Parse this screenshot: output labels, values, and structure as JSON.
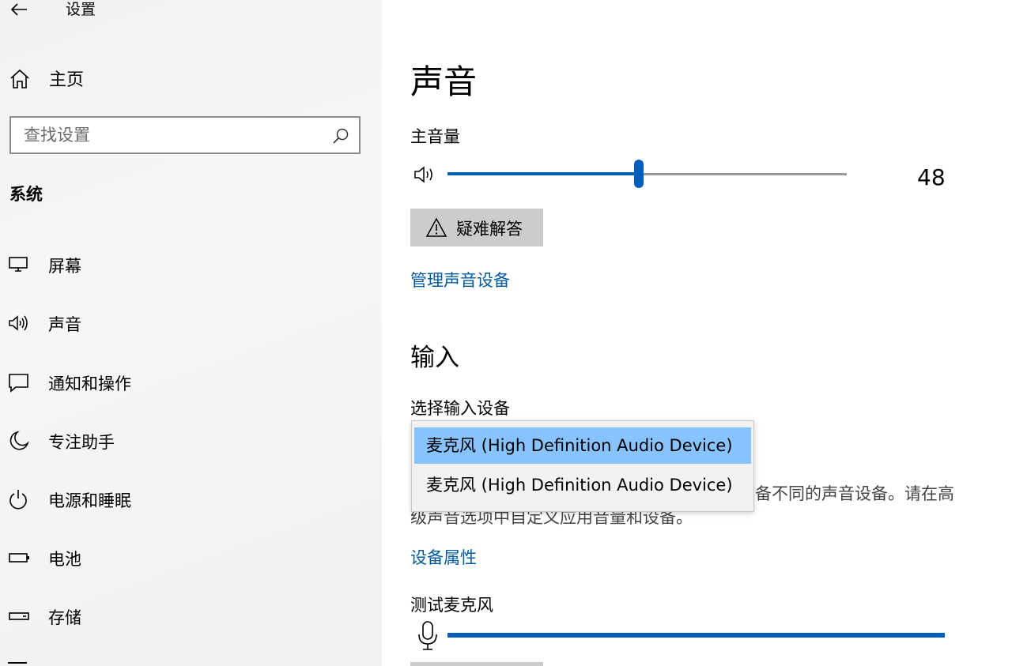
{
  "window": {
    "title": "设置"
  },
  "sidebar": {
    "home_label": "主页",
    "search_placeholder": "查找设置",
    "section_label": "系统",
    "items": [
      {
        "label": "屏幕",
        "icon": "monitor-icon"
      },
      {
        "label": "声音",
        "icon": "speaker-icon"
      },
      {
        "label": "通知和操作",
        "icon": "notification-icon"
      },
      {
        "label": "专注助手",
        "icon": "moon-icon"
      },
      {
        "label": "电源和睡眠",
        "icon": "power-icon"
      },
      {
        "label": "电池",
        "icon": "battery-icon"
      },
      {
        "label": "存储",
        "icon": "storage-icon"
      }
    ]
  },
  "main": {
    "title": "声音",
    "master_volume_label": "主音量",
    "volume": 48,
    "volume_display": "48",
    "troubleshoot_label": "疑难解答",
    "manage_devices_link": "管理声音设备",
    "input_title": "输入",
    "select_input_label": "选择输入设备",
    "input_options": [
      "麦克风 (High Definition Audio Device)",
      "麦克风 (High Definition Audio Device)"
    ],
    "selected_option_index": 0,
    "description_visible": "备不同的声音设备。请在高",
    "description_line2": "级声音选项中自定义应用音量和设备。",
    "device_properties_link": "设备属性",
    "test_mic_label": "测试麦克风"
  },
  "colors": {
    "accent": "#005fb8",
    "link": "#005a9e",
    "selected_option": "#87c3ff",
    "button_bg": "#cccccc"
  }
}
